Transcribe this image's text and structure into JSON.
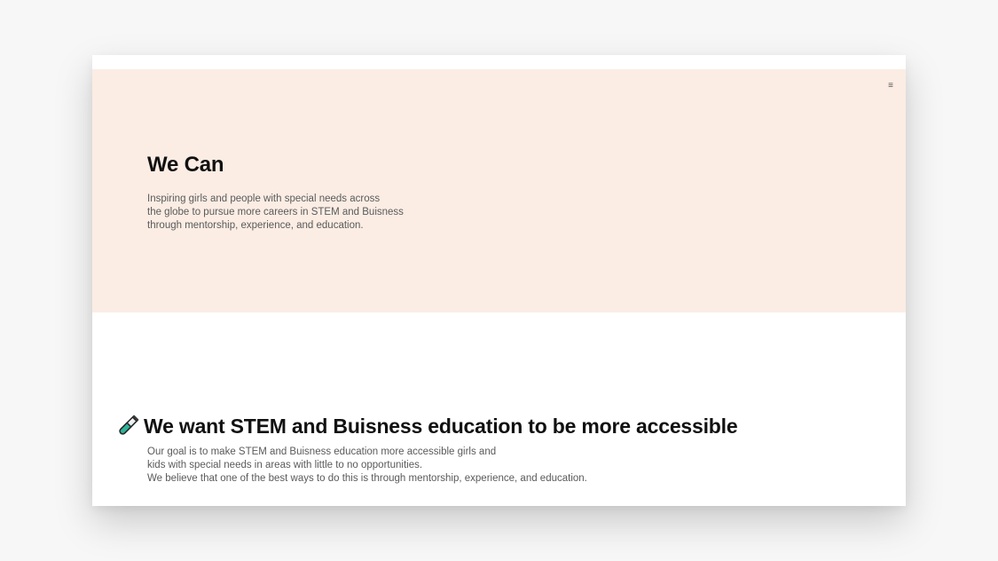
{
  "header": {
    "menu_icon": "hamburger-menu-icon",
    "menu_glyph": "≡"
  },
  "hero": {
    "title": "We Can",
    "description_lines": [
      "Inspiring girls and people with special needs across",
      "the globe to pursue more careers in STEM and Buisness",
      "through mentorship, experience, and education."
    ],
    "background_color": "#fbede4"
  },
  "section": {
    "icon": "test-tube-icon",
    "heading": "We want STEM and Buisness education to be more accessible",
    "description_lines": [
      "Our goal is to make STEM and Buisness education more accessible girls and",
      "kids with special needs in areas with little to no opportunities.",
      "We believe that one of the best ways to do this is through mentorship, experience, and education."
    ]
  }
}
